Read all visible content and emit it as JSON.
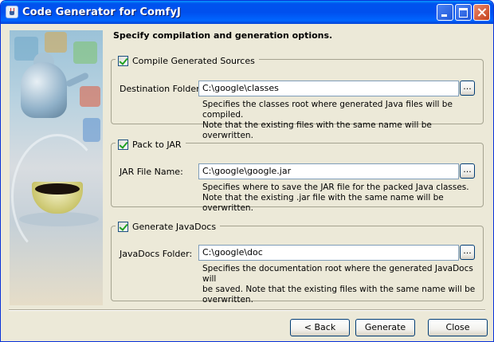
{
  "window": {
    "title": "Code Generator for ComfyJ"
  },
  "heading": "Specify compilation and generation options.",
  "sections": [
    {
      "checkbox_label": "Compile Generated Sources",
      "checked": true,
      "field_label": "Destination Folder:",
      "field_value": "C:\\google\\classes",
      "browse_label": "...",
      "description": [
        "Specifies the classes root where generated Java files will be compiled.",
        "Note that the existing files with the same name will be overwritten."
      ]
    },
    {
      "checkbox_label": "Pack to JAR",
      "checked": true,
      "field_label": "JAR File Name:",
      "field_value": "C:\\google\\google.jar",
      "browse_label": "...",
      "description": [
        "Specifies where to save the JAR file for the packed Java classes.",
        "Note that the existing .jar file with the same name will be overwritten."
      ]
    },
    {
      "checkbox_label": "Generate JavaDocs",
      "checked": true,
      "field_label": "JavaDocs Folder:",
      "field_value": "C:\\google\\doc",
      "browse_label": "...",
      "description": [
        "Specifies the documentation root where the generated JavaDocs will",
        "be saved. Note that the existing files with the same name will be",
        "overwritten."
      ]
    }
  ],
  "buttons": {
    "back": "< Back",
    "generate": "Generate",
    "close": "Close"
  }
}
